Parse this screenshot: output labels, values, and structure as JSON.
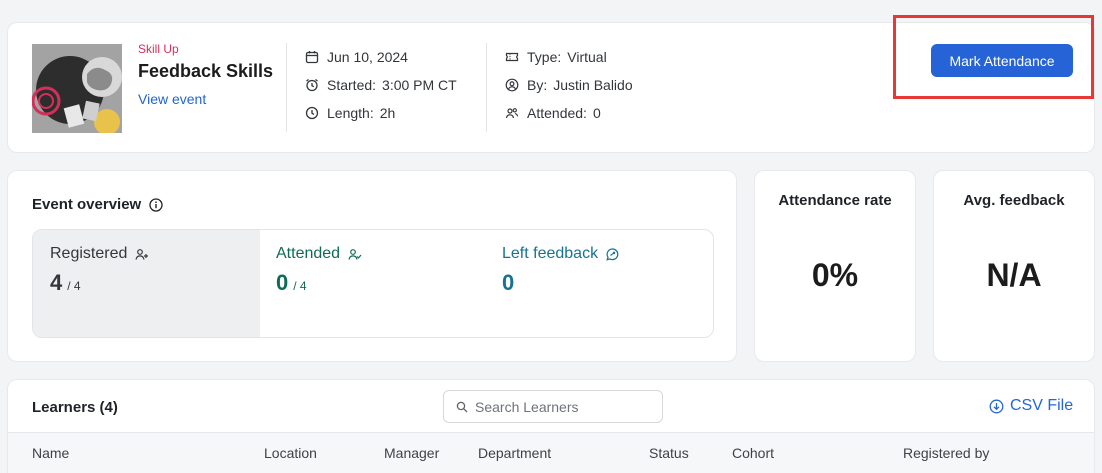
{
  "event": {
    "category": "Skill Up",
    "title": "Feedback Skills",
    "view_link": "View event",
    "date": "Jun 10, 2024",
    "started_label": "Started:",
    "started_value": "3:00 PM CT",
    "length_label": "Length:",
    "length_value": "2h",
    "type_label": "Type:",
    "type_value": "Virtual",
    "by_label": "By:",
    "by_value": "Justin Balido",
    "attended_label": "Attended:",
    "attended_value": "0",
    "mark_attendance_label": "Mark Attendance"
  },
  "overview": {
    "title": "Event overview",
    "registered": {
      "label": "Registered",
      "value": "4",
      "of": "/ 4"
    },
    "attended": {
      "label": "Attended",
      "value": "0",
      "of": "/ 4"
    },
    "left_feedback": {
      "label": "Left feedback",
      "value": "0"
    }
  },
  "attendance_rate": {
    "title": "Attendance rate",
    "value": "0%"
  },
  "avg_feedback": {
    "title": "Avg. feedback",
    "value": "N/A"
  },
  "learners": {
    "title": "Learners (4)",
    "search_placeholder": "Search Learners",
    "csv_label": "CSV File",
    "columns": [
      "Name",
      "Location",
      "Manager",
      "Department",
      "Status",
      "Cohort",
      "Registered by"
    ]
  },
  "colors": {
    "accent": "#2563d6",
    "category": "#d3305c",
    "attended": "#0f6b57",
    "feedback": "#187291",
    "highlight": "#e53935"
  }
}
